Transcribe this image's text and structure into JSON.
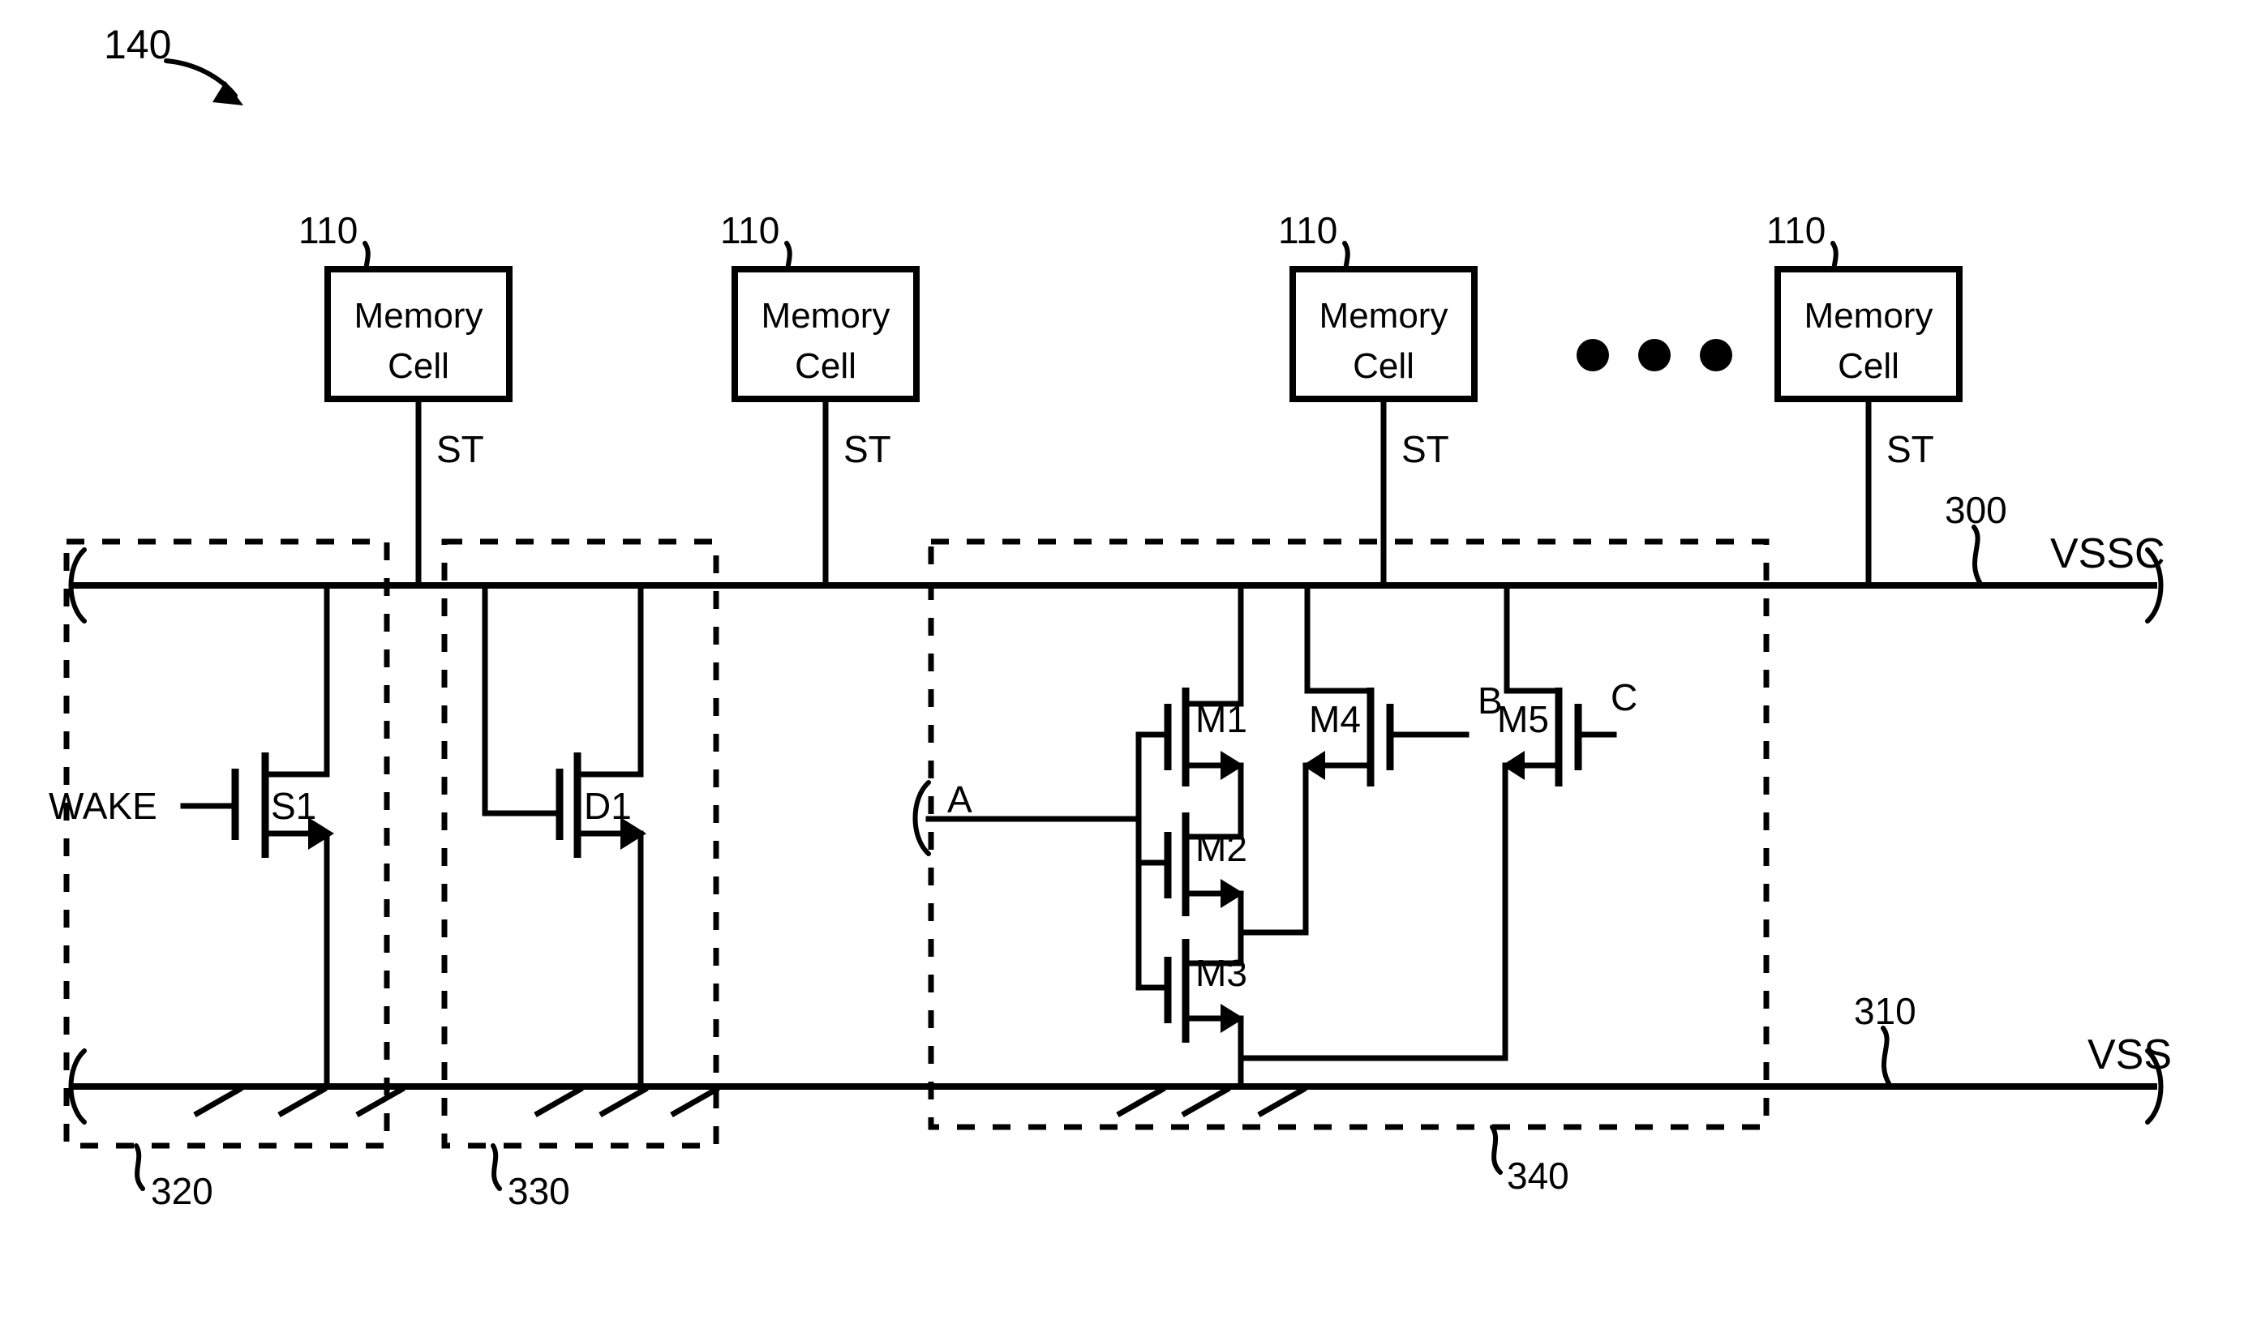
{
  "figure": {
    "id_label": "140",
    "domain": "patent-circuit-diagram"
  },
  "memory_cells": [
    {
      "ref": "110",
      "title_line1": "Memory",
      "title_line2": "Cell",
      "signal": "ST"
    },
    {
      "ref": "110",
      "title_line1": "Memory",
      "title_line2": "Cell",
      "signal": "ST"
    },
    {
      "ref": "110",
      "title_line1": "Memory",
      "title_line2": "Cell",
      "signal": "ST"
    },
    {
      "ref": "110",
      "title_line1": "Memory",
      "title_line2": "Cell",
      "signal": "ST"
    }
  ],
  "ellipsis": "• • •",
  "rails": [
    {
      "ref": "300",
      "name": "VSSC"
    },
    {
      "ref": "310",
      "name": "VSS"
    }
  ],
  "blocks": [
    {
      "ref": "320",
      "device": "S1",
      "input_label": "WAKE"
    },
    {
      "ref": "330",
      "device": "D1"
    },
    {
      "ref": "340",
      "devices": [
        "M1",
        "M2",
        "M3",
        "M4",
        "M5"
      ],
      "nodes": [
        "A",
        "B",
        "C"
      ]
    }
  ],
  "devices": {
    "s1": "S1",
    "d1": "D1",
    "m1": "M1",
    "m2": "M2",
    "m3": "M3",
    "m4": "M4",
    "m5": "M5"
  },
  "signals": {
    "wake": "WAKE",
    "a": "A",
    "b": "B",
    "c": "C",
    "st": "ST"
  },
  "refs": {
    "fig": "140",
    "cell": "110",
    "vssc": "300",
    "vss": "310",
    "switch_block": "320",
    "diode_block": "330",
    "driver_block": "340"
  },
  "rail_names": {
    "vssc": "VSSC",
    "vss": "VSS"
  }
}
